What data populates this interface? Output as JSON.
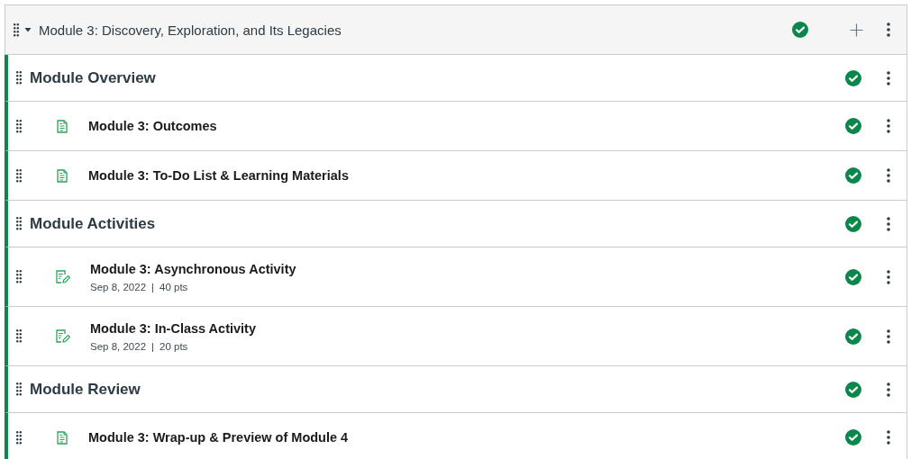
{
  "module": {
    "title": "Module 3: Discovery, Exploration, and Its Legacies",
    "expanded": true,
    "published": true
  },
  "items": [
    {
      "kind": "subheader",
      "title": "Module Overview",
      "published": true
    },
    {
      "kind": "page",
      "title": "Module 3: Outcomes",
      "published": true
    },
    {
      "kind": "page",
      "title": "Module 3: To-Do List & Learning Materials",
      "published": true
    },
    {
      "kind": "subheader",
      "title": "Module Activities",
      "published": true
    },
    {
      "kind": "assignment",
      "title": "Module 3: Asynchronous Activity",
      "date": "Sep 8, 2022",
      "separator": "|",
      "points": "40 pts",
      "published": true
    },
    {
      "kind": "assignment",
      "title": "Module 3: In-Class Activity",
      "date": "Sep 8, 2022",
      "separator": "|",
      "points": "20 pts",
      "published": true
    },
    {
      "kind": "subheader",
      "title": "Module Review",
      "published": true
    },
    {
      "kind": "page",
      "title": "Module 3: Wrap-up & Preview of Module 4",
      "published": true
    }
  ]
}
